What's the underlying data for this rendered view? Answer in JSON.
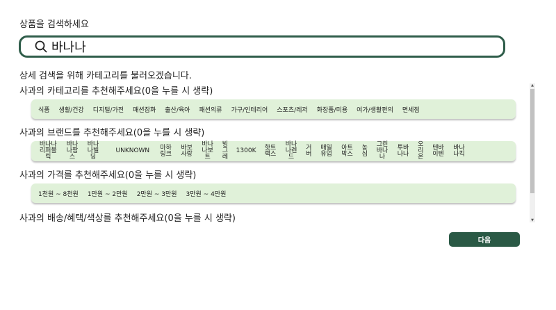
{
  "title": "상품을 검색하세요",
  "search": {
    "value": "바나나"
  },
  "info": "상세 검색을 위해 카테고리를 불러오겠습니다.",
  "sections": [
    {
      "heading": "사과의 카테고리를 추천해주세요(0을 누를 시 생략)",
      "options": [
        "식품",
        "생활/건강",
        "디지털/가전",
        "패션잡화",
        "출산/육아",
        "패션의류",
        "가구/인테리어",
        "스포츠/레저",
        "화장품/미용",
        "여가/생활편의",
        "면세점"
      ]
    },
    {
      "heading": "사과의 브랜드를 추천해주세요(0을 누를 시 생략)",
      "options": [
        "바나나리퍼블릭",
        "바나나팜스",
        "바나나빌딩",
        "UNKNOWN",
        "마하링크",
        "바보사랑",
        "바나나보트",
        "빙그레",
        "1300K",
        "핫트랙스",
        "바나나렌드",
        "거버",
        "매일유업",
        "아트박스",
        "농심",
        "그린바나나",
        "투바나나",
        "오리온",
        "텐바이텐",
        "바나나킥"
      ]
    },
    {
      "heading": "사과의 가격를 추천해주세요(0을 누를 시 생략)",
      "options": [
        "1천원 ~ 8천원",
        "1만원 ~ 2만원",
        "2만원 ~ 3만원",
        "3만원 ~ 4만원"
      ]
    },
    {
      "heading": "사과의 배송/혜택/색상를 추천해주세요(0을 누를 시 생략)"
    }
  ],
  "next_label": "다음"
}
